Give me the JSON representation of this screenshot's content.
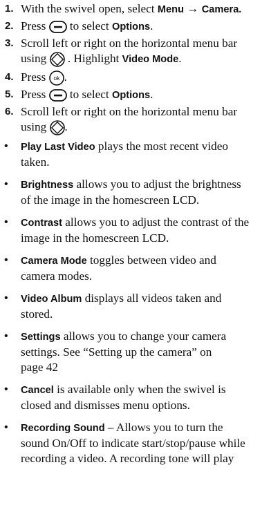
{
  "steps": [
    {
      "num": "1.",
      "a": "With the swivel open, select ",
      "b1": "Menu",
      "arrow": " → ",
      "b2": "Camera."
    },
    {
      "num": "2.",
      "a": "Press",
      "b": "to select",
      "c": "Options",
      "d": "."
    },
    {
      "num": "3.",
      "l1": "Scroll left or right on the horizontal menu bar",
      "l2a": "using",
      "l2b": ". Highlight",
      "l2c": "Video Mode",
      "l2d": "."
    },
    {
      "num": "4.",
      "a": "Press",
      "b": "."
    },
    {
      "num": "5.",
      "a": "Press",
      "b": "to select",
      "c": "Options",
      "d": "."
    },
    {
      "num": "6.",
      "l1": "Scroll left or right on the horizontal menu bar",
      "l2a": "using",
      "l2b": "."
    }
  ],
  "bullet_char": "•",
  "bullets": [
    {
      "term": "Play Last Video",
      "l1": "plays the most recent video",
      "l2": "taken."
    },
    {
      "term": "Brightness",
      "l1": "allows you to adjust the brightness",
      "l2": "of the image in the homescreen LCD."
    },
    {
      "term": "Contrast",
      "l1": "allows you to adjust the contrast of the",
      "l2": "image in the homescreen LCD."
    },
    {
      "term": "Camera Mode",
      "l1": "toggles between video and",
      "l2": "camera modes."
    },
    {
      "term": "Video Album",
      "l1": "displays all videos taken and",
      "l2": "stored."
    },
    {
      "term": "Settings",
      "l1": "allows you to change your camera",
      "l2": "settings. See “Setting up the camera” on",
      "l3": "page 42"
    },
    {
      "term": "Cancel",
      "l1": "is available only when the swivel is",
      "l2": "closed and dismisses menu options."
    },
    {
      "term": "Recording Sound",
      "l1": "– Allows you to turn the",
      "l2": "sound On/Off to indicate start/stop/pause while",
      "l3": "recording a video. A recording tone will play"
    }
  ],
  "icons": {
    "ok_label": "ok",
    "soft_key": "soft-key-icon",
    "nav_pad": "navigation-pad-icon",
    "ok_key": "ok-key-icon"
  }
}
